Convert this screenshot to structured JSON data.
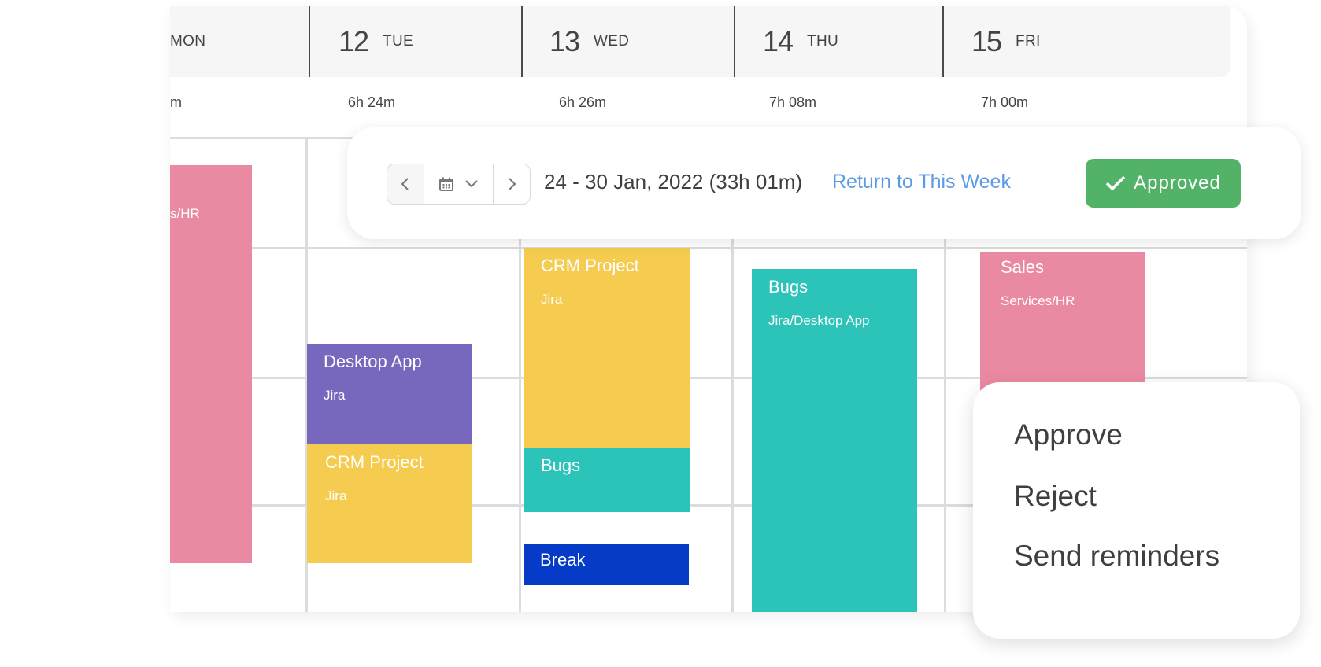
{
  "days": [
    {
      "num": "",
      "name": "MON",
      "total": "m"
    },
    {
      "num": "12",
      "name": "TUE",
      "total": "6h 24m"
    },
    {
      "num": "13",
      "name": "WED",
      "total": "6h 26m"
    },
    {
      "num": "14",
      "name": "THU",
      "total": "7h 08m"
    },
    {
      "num": "15",
      "name": "FRI",
      "total": "7h 00m"
    }
  ],
  "events": {
    "mon_sales": {
      "title": "",
      "sub": "s/HR",
      "color": "#ea8aa2"
    },
    "tue_desktop": {
      "title": "Desktop App",
      "sub": "Jira",
      "color": "#7767bd"
    },
    "tue_crm": {
      "title": "CRM Project",
      "sub": "Jira",
      "color": "#f5cb50"
    },
    "wed_crm": {
      "title": "CRM Project",
      "sub": "Jira",
      "color": "#f5cb50"
    },
    "wed_bugs": {
      "title": "Bugs",
      "sub": "",
      "color": "#2cc3b8"
    },
    "wed_break": {
      "title": "Break",
      "sub": "",
      "color": "#053bc6"
    },
    "thu_bugs": {
      "title": "Bugs",
      "sub": "Jira/Desktop App",
      "color": "#2cc3b8"
    },
    "fri_sales": {
      "title": "Sales",
      "sub": "Services/HR",
      "color": "#ea8aa2"
    }
  },
  "toolbar": {
    "prev_icon": "chevron-left-icon",
    "calendar_icon": "calendar-icon",
    "dropdown_icon": "chevron-down-icon",
    "next_icon": "chevron-right-icon",
    "week_range": "24 - 30 Jan, 2022 (33h 01m)",
    "return_label": "Return to This Week",
    "approved_label": "Approved",
    "approved_color": "#52b368",
    "link_color": "#5b9be5"
  },
  "menu": {
    "items": [
      "Approve",
      "Reject",
      "Send reminders"
    ]
  }
}
